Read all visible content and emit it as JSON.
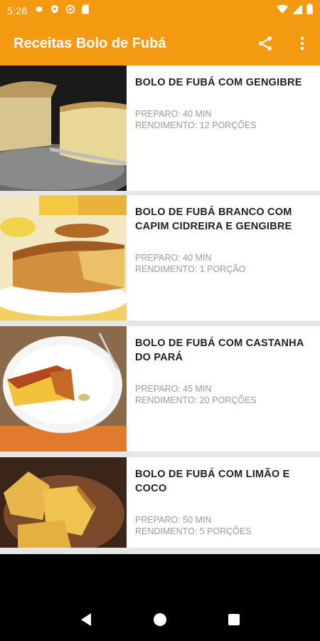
{
  "status_bar": {
    "time": "5:26",
    "left_icons": [
      "gear-icon",
      "shield-icon",
      "data-saver-icon",
      "sd-card-icon"
    ],
    "right_icons": [
      "wifi-icon",
      "signal-icon",
      "battery-icon"
    ]
  },
  "app_bar": {
    "title": "Receitas Bolo de Fubá",
    "actions": [
      "share-icon",
      "more-vert-icon"
    ],
    "color": "#F39A11"
  },
  "recipes": [
    {
      "title": "BOLO DE FUBÁ COM GENGIBRE",
      "prep": "PREPARO: 40 MIN",
      "yield": "RENDIMENTO: 12 PORÇÕES"
    },
    {
      "title": "BOLO DE FUBÁ BRANCO COM CAPIM CIDREIRA E GENGIBRE",
      "prep": "PREPARO: 40 MIN",
      "yield": "RENDIMENTO: 1 PORÇÃO"
    },
    {
      "title": "BOLO DE FUBÁ COM CASTANHA DO PARÁ",
      "prep": "PREPARO: 45 MIN",
      "yield": "RENDIMENTO: 20 PORÇÕES"
    },
    {
      "title": "BOLO DE FUBÁ COM LIMÃO E COCO",
      "prep": "PREPARO: 50 MIN",
      "yield": "RENDIMENTO: 5 PORÇÕES"
    }
  ],
  "nav_bar": {
    "buttons": [
      "back-icon",
      "home-icon",
      "recents-icon"
    ]
  }
}
